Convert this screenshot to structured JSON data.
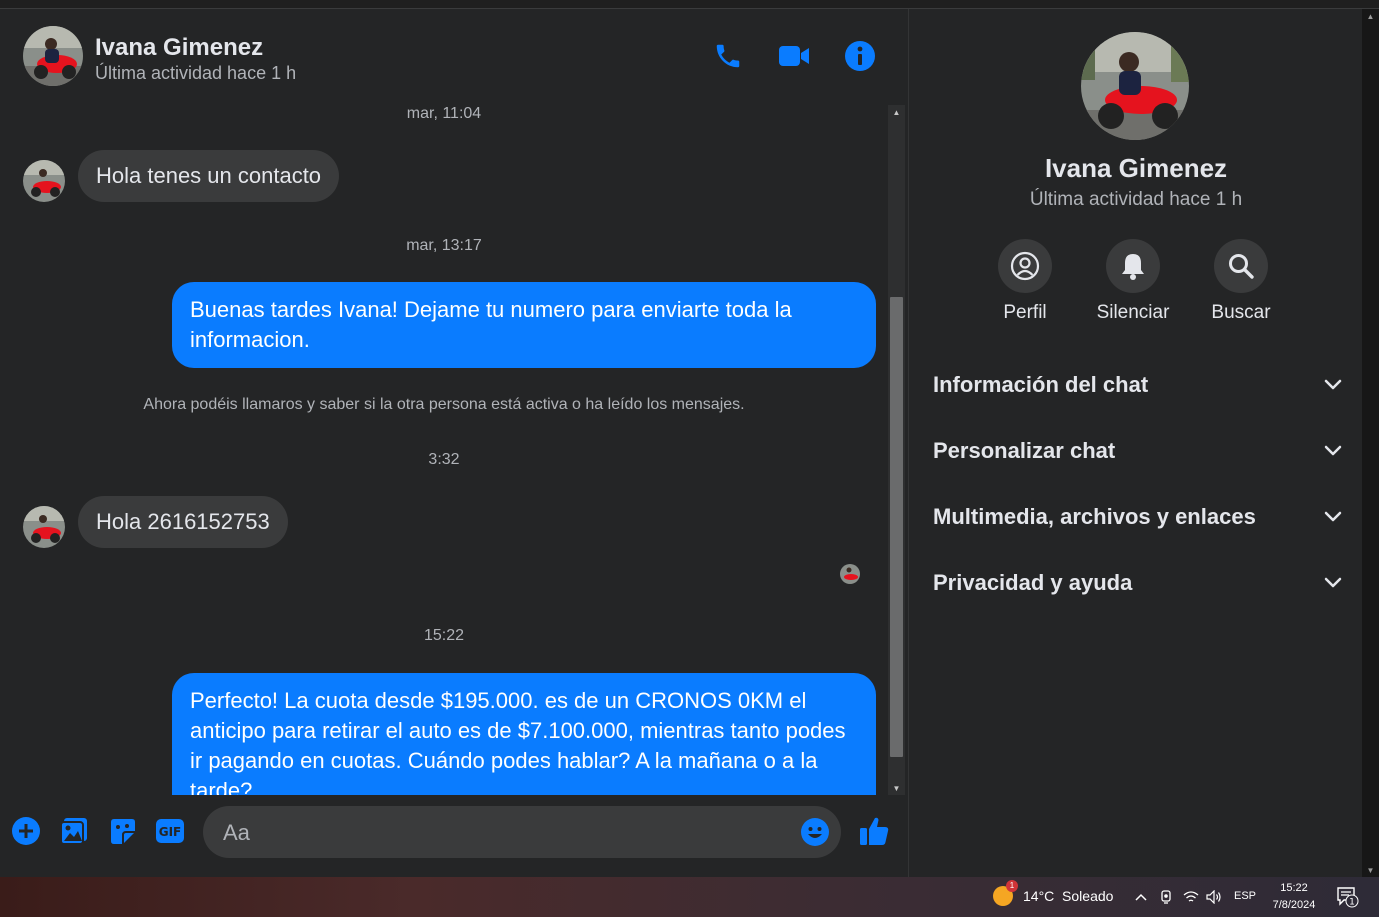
{
  "header": {
    "contact_name": "Ivana Gimenez",
    "status": "Última actividad hace 1 h",
    "icons": [
      "phone-icon",
      "video-camera-icon",
      "info-icon"
    ]
  },
  "messages": {
    "stamp_1": "mar, 11:04",
    "incoming_1": "Hola tenes un contacto",
    "stamp_2": "mar, 13:17",
    "outgoing_1": "Buenas tardes Ivana! Dejame tu numero para enviarte toda la informacion.",
    "notice": "Ahora podéis llamaros y saber si la otra persona está activa o ha leído los mensajes.",
    "stamp_3": "3:32",
    "incoming_2": "Hola 2616152753",
    "stamp_4": "15:22",
    "outgoing_2": "Perfecto! La cuota desde $195.000. es de un CRONOS 0KM el anticipo para retirar el auto es de $7.100.000, mientras tanto podes ir pagando en cuotas. Cuándo podes hablar? A la mañana o a la tarde?"
  },
  "composer": {
    "placeholder": "Aa",
    "icons": [
      "plus-circle-icon",
      "image-icon",
      "sticker-icon",
      "gif-icon",
      "emoji-icon",
      "thumbs-up-icon"
    ]
  },
  "panel": {
    "name": "Ivana Gimenez",
    "status": "Última actividad hace 1 h",
    "actions": [
      {
        "label": "Perfil",
        "icon": "profile-icon"
      },
      {
        "label": "Silenciar",
        "icon": "bell-icon"
      },
      {
        "label": "Buscar",
        "icon": "search-icon"
      }
    ],
    "sections": [
      "Información del chat",
      "Personalizar chat",
      "Multimedia, archivos y enlaces",
      "Privacidad y ayuda"
    ]
  },
  "taskbar": {
    "weather": "14°C  Soleado",
    "weather_badge": "1",
    "language": "ESP",
    "time": "15:22",
    "date": "7/8/2024",
    "notification_count": "1"
  },
  "colors": {
    "accent": "#0a7cff",
    "background": "#242526",
    "bubble_incoming": "#3a3b3c"
  }
}
